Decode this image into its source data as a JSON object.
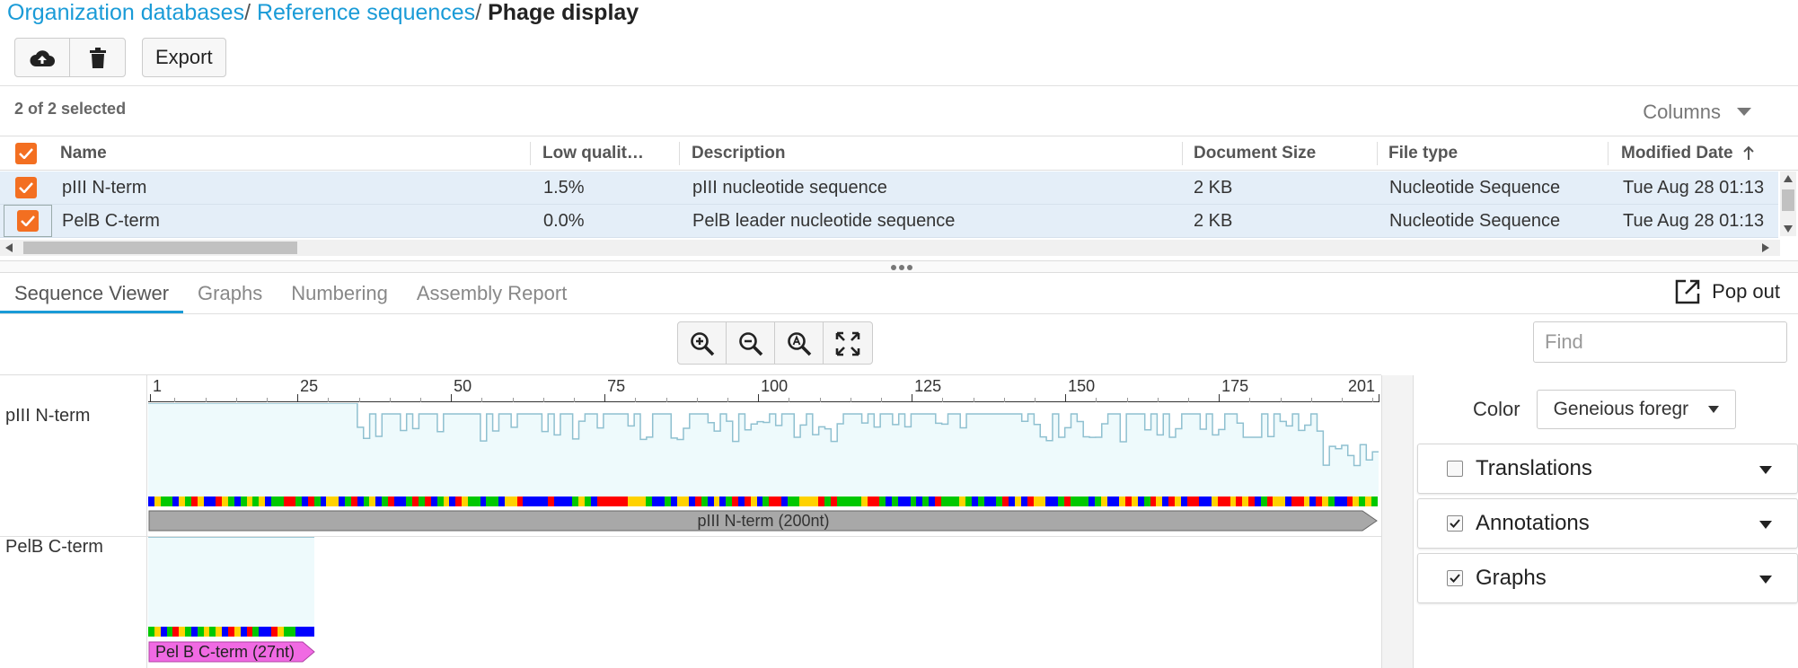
{
  "breadcrumb": {
    "items": [
      "Organization databases",
      "Reference sequences"
    ],
    "separator": "/",
    "current": "Phage display"
  },
  "toolbar": {
    "upload_icon": "cloud-upload-icon",
    "delete_icon": "trash-icon",
    "export_label": "Export"
  },
  "selection": {
    "count_text": "2 of 2 selected"
  },
  "columns_menu": {
    "label": "Columns"
  },
  "table": {
    "columns": [
      "Name",
      "Low qualit…",
      "Description",
      "Document Size",
      "File type",
      "Modified Date"
    ],
    "sort": {
      "column": "Modified Date",
      "direction": "ascending"
    },
    "rows": [
      {
        "name": "pIII N-term",
        "low_quality": "1.5%",
        "description": "pIII nucleotide sequence",
        "size": "2 KB",
        "type": "Nucleotide Sequence",
        "modified": "Tue Aug 28 01:13",
        "checked": true
      },
      {
        "name": "PelB C-term",
        "low_quality": "0.0%",
        "description": "PelB leader nucleotide sequence",
        "size": "2 KB",
        "type": "Nucleotide Sequence",
        "modified": "Tue Aug 28 01:13",
        "checked": true
      }
    ]
  },
  "tabs": [
    {
      "label": "Sequence Viewer",
      "active": true
    },
    {
      "label": "Graphs",
      "active": false
    },
    {
      "label": "Numbering",
      "active": false
    },
    {
      "label": "Assembly Report",
      "active": false
    }
  ],
  "popout": {
    "label": "Pop out"
  },
  "zoom": {
    "icons": [
      "zoom-in-icon",
      "zoom-out-icon",
      "zoom-to-selection-icon",
      "fit-to-window-icon"
    ]
  },
  "find": {
    "placeholder": "Find",
    "value": ""
  },
  "ruler": {
    "labels": [
      "1",
      "25",
      "50",
      "75",
      "100",
      "125",
      "150",
      "175",
      "201"
    ],
    "positions": [
      1,
      25,
      50,
      75,
      100,
      125,
      150,
      175,
      201
    ]
  },
  "sequences": [
    {
      "name": "pIII N-term",
      "length": 200,
      "annotation": "pIII N-term (200nt)",
      "annotation_color": "#a8a8a8"
    },
    {
      "name": "PelB C-term",
      "length": 27,
      "annotation": "Pel B C-term (27nt)",
      "annotation_color": "#f06ae3"
    }
  ],
  "panel": {
    "color_label": "Color",
    "color_value": "Geneious foregr",
    "sections": [
      {
        "label": "Translations",
        "checked": false
      },
      {
        "label": "Annotations",
        "checked": true
      },
      {
        "label": "Graphs",
        "checked": true
      }
    ]
  },
  "colors": {
    "accent": "#1a9bd7",
    "checkbox": "#f36f21",
    "row_selected": "#e4eef8",
    "graph_fill": "#eefafc",
    "graph_line": "#8fc0d0",
    "base_A": "#00c800",
    "base_C": "#0000ff",
    "base_G": "#ffd200",
    "base_T": "#ff0000"
  }
}
